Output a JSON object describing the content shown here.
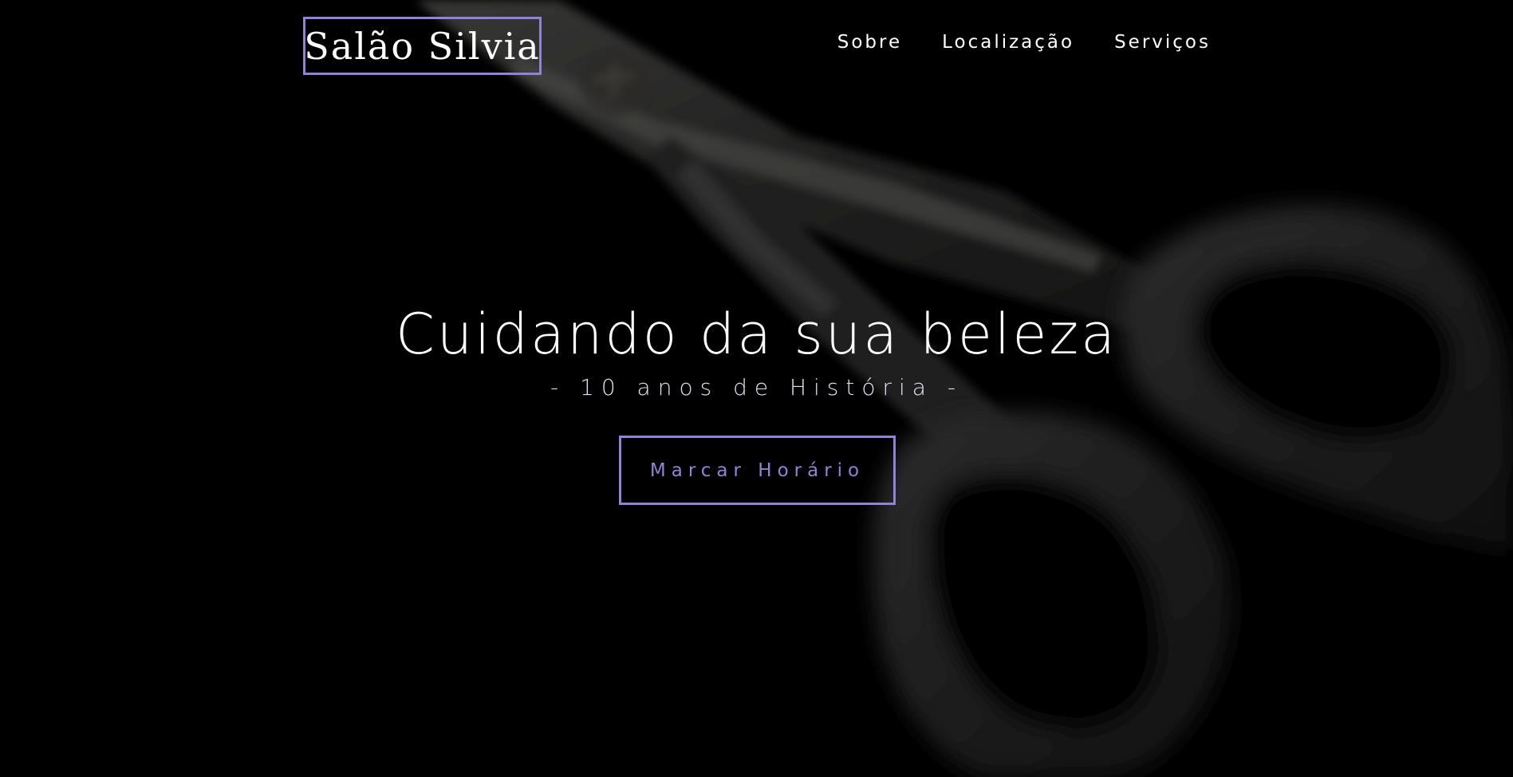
{
  "header": {
    "logo_text": "Salão Silvia",
    "nav": [
      {
        "label": "Sobre"
      },
      {
        "label": "Localização"
      },
      {
        "label": "Serviços"
      }
    ]
  },
  "hero": {
    "title": "Cuidando da sua beleza",
    "subtitle": "- 10 anos de História -",
    "cta_label": "Marcar Horário",
    "background_image": "scissors-photo"
  },
  "colors": {
    "background": "#000000",
    "accent": "#8f84d6",
    "text": "#ffffff"
  }
}
